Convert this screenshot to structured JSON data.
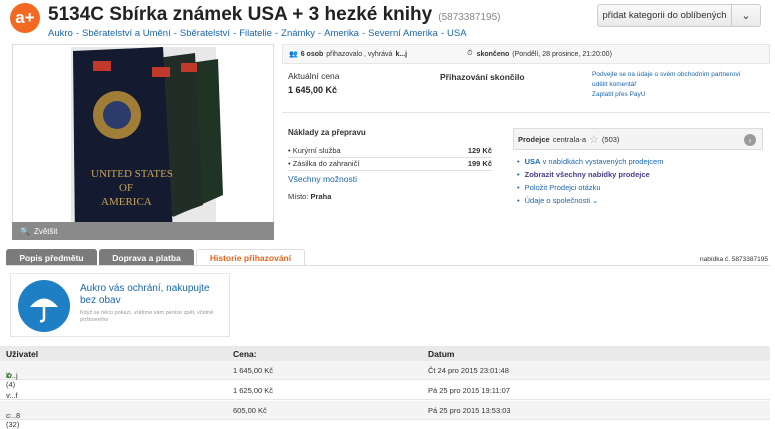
{
  "header": {
    "logo": "a+",
    "title": "5134C Sbírka známek USA + 3 hezké knihy",
    "item_id": "(5873387195)",
    "breadcrumbs": [
      "Aukro",
      "Sběratelství a Umění",
      "Sběratelství",
      "Filatelie",
      "Známky",
      "Amerika",
      "Severní Amerika",
      "USA"
    ],
    "breadcrumb_separator": "-",
    "favorites_button": "přidat kategorii do oblíbených",
    "favorites_dropdown": "⌄"
  },
  "gallery": {
    "zoom_label": "Zvětšit",
    "book_text_line1": "UNITED STATES",
    "book_text_line2": "OF",
    "book_text_line3": "AMERICA"
  },
  "infobar": {
    "bidders": "6 osob",
    "bidders_suffix": "přihazovalo , vyhrává",
    "winner": "k...j",
    "ended_label": "skončeno",
    "ended_date": "(Pondělí, 28 prosince, 21:20:00)"
  },
  "price": {
    "label": "Aktuální cena",
    "value": "1 645,00 Kč",
    "status": "Přihazování skončilo"
  },
  "partner": {
    "line1": "Podvejte se na údaje o svém obchodním partnerovi",
    "line2": "udělit komentář",
    "line3": "Zaplatit přes PayU"
  },
  "shipping": {
    "title": "Náklady za přepravu",
    "rows": [
      {
        "name": "Kurýrní služba",
        "price": "129 Kč"
      },
      {
        "name": "Zásilka do zahraničí",
        "price": "199 Kč"
      }
    ],
    "all_options": "Všechny možnosti",
    "place_label": "Místo:",
    "place_value": "Praha"
  },
  "seller": {
    "label": "Prodejce",
    "name": "centrala-a",
    "rating": "(503)",
    "dot": "›",
    "links": [
      {
        "strong": "USA",
        "text": " v nabídkách vystavených prodejcem"
      },
      {
        "strong": "",
        "text": "Zobrazit všechny nabídky prodejce"
      },
      {
        "strong": "",
        "text": "Položit Prodejci otázku"
      },
      {
        "strong": "",
        "text": "Údaje o společnosti  ⌄"
      }
    ]
  },
  "tabs": [
    {
      "label": "Popis předmětu"
    },
    {
      "label": "Doprava a platba"
    },
    {
      "label": "Historie přihazování"
    }
  ],
  "offer_number": "nabídka č. 5873387195",
  "protection": {
    "heading": "Aukro vás ochrání, nakupujte bez obav",
    "text": "Když se něco pokazí, vrátíme vám peníze zpět, včetně poštovného"
  },
  "bids": {
    "columns": [
      "Uživatel",
      "Cena:",
      "Datum"
    ],
    "rows": [
      {
        "user": "k...j (4)",
        "price": "1 645,00 Kč",
        "date": "Čt 24 pro 2015 23:01:48"
      },
      {
        "user": "v...f (45)",
        "price": "1 625,00 Kč",
        "date": "Pá 25 pro 2015 19:11:07"
      },
      {
        "user": "c...8 (32)",
        "price": "605,00 Kč",
        "date": "Pá 25 pro 2015 13:53:03"
      }
    ]
  },
  "colors": {
    "brand": "#f26a21",
    "link": "#1a66b3",
    "tab_active": "#e8641c"
  }
}
